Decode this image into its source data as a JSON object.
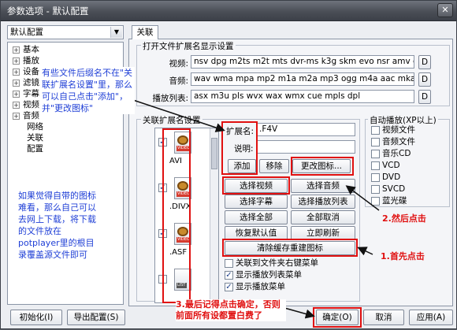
{
  "window": {
    "title": "参数选项 - 默认配置",
    "close_label": "✕"
  },
  "sidebar": {
    "profile": "默认配置",
    "tree": [
      {
        "label": "基本",
        "expander": "+"
      },
      {
        "label": "播放",
        "expander": "+"
      },
      {
        "label": "设备",
        "expander": "+"
      },
      {
        "label": "滤镜",
        "expander": "+"
      },
      {
        "label": "字幕",
        "expander": "+"
      },
      {
        "label": "视频",
        "expander": "+"
      },
      {
        "label": "音频",
        "expander": "+"
      },
      {
        "label": "网络",
        "expander": ""
      },
      {
        "label": "关联",
        "expander": ""
      },
      {
        "label": "配置",
        "expander": ""
      }
    ]
  },
  "tabs": [
    {
      "label": "关联"
    }
  ],
  "ext_display": {
    "group_label": "打开文件扩展名显示设置",
    "rows": [
      {
        "label": "视频:",
        "value": "nsv dpg m2ts m2t mts dvr-ms k3g skm evo nsr amv divx webm",
        "button": "D"
      },
      {
        "label": "音频:",
        "value": "wav wma mpa mp2 m1a m2a mp3 ogg m4a aac mka ra flac ape",
        "button": "D"
      },
      {
        "label": "播放列表:",
        "value": "asx m3u pls wvx wax wmx cue mpls dpl",
        "button": "D"
      }
    ]
  },
  "assoc": {
    "group_label": "关联扩展名设置",
    "icons": [
      {
        "ext": "AVI",
        "tag": "VIDEO",
        "checked": "✓"
      },
      {
        "ext": ".DIVX",
        "tag": "VIDEO",
        "checked": "✓"
      },
      {
        "ext": ".ASF",
        "tag": "VIDEO",
        "checked": "✓"
      },
      {
        "ext": "",
        "tag": "LIST",
        "checked": ""
      }
    ],
    "ext_label": "扩展名:",
    "ext_value": ".F4V",
    "desc_label": "说明:",
    "desc_value": "",
    "add_label": "添加",
    "remove_label": "移除",
    "change_icon_label": "更改图标...",
    "buttons": [
      "选择视频",
      "选择音频",
      "选择字幕",
      "选择播放列表",
      "选择全部",
      "全部取消",
      "恢复默认值",
      "立即刷新"
    ],
    "clear_cache_label": "清除缓存重建图标",
    "checks": [
      {
        "label": "关联到文件夹右键菜单",
        "checked": ""
      },
      {
        "label": "显示播放列表菜单",
        "checked": "✓"
      },
      {
        "label": "显示播放菜单",
        "checked": "✓"
      }
    ]
  },
  "autoplay": {
    "label": "自动播放(XP以上)",
    "items": [
      "视频文件",
      "音频文件",
      "音乐CD",
      "VCD",
      "DVD",
      "SVCD",
      "蓝光碟"
    ]
  },
  "footer": {
    "init_label": "初始化(I)",
    "export_label": "导出配置(S)",
    "ok_label": "确定(O)",
    "cancel_label": "取消",
    "apply_label": "应用(A)"
  },
  "annotations": {
    "tip_top": "有些文件后缀名不在\"关联扩展名设置\"里，那么可以自己点击\"添加\"，并\"更改图标\"",
    "tip_left": "如果觉得自带的图标难看，那么自己可以去网上下载，将下载的文件放在potplayer里的根目录覆盖源文件即可",
    "step1": "1.首先点击",
    "step2": "2.然后点击",
    "step3": "3.最后记得点击确定，否则前面所有设都置白费了"
  },
  "colors": {
    "annotation_blue": "#1f3fd6",
    "annotation_red": "#e01010"
  }
}
